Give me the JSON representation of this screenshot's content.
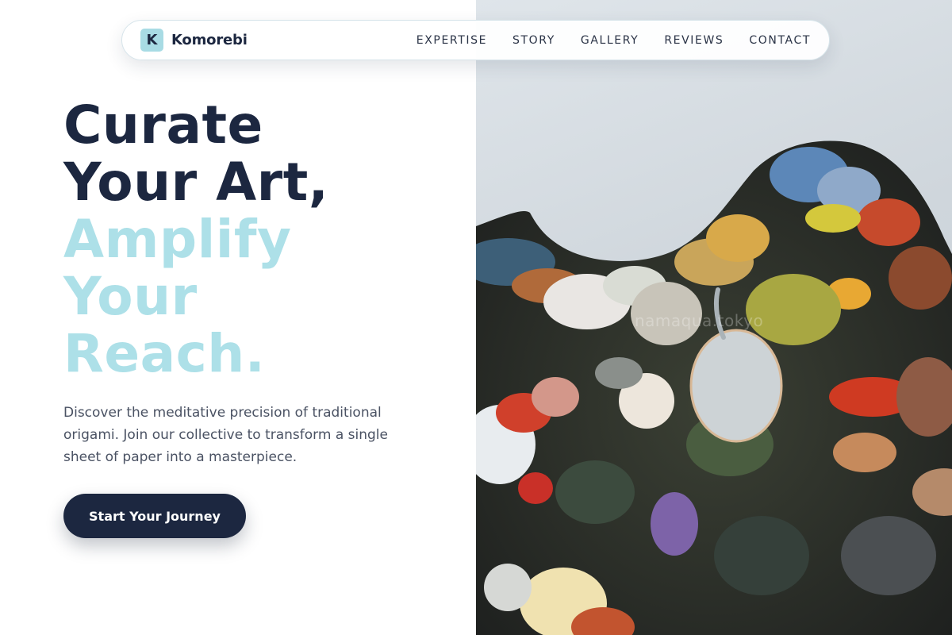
{
  "brand": {
    "mark": "K",
    "name": "Komorebi"
  },
  "nav": {
    "links": [
      "EXPERTISE",
      "STORY",
      "GALLERY",
      "REVIEWS",
      "CONTACT"
    ]
  },
  "hero": {
    "headline_dark": [
      "Curate",
      "Your Art,"
    ],
    "headline_light": [
      "Amplify",
      "Your",
      "Reach."
    ],
    "description": "Discover the meditative precision of traditional origami. Join our collective to transform a single sheet of paper into a masterpiece.",
    "cta_label": "Start Your Journey"
  },
  "image": {
    "subject": "paint-palette-photo",
    "watermark": "namaqua.tokyo"
  },
  "colors": {
    "navy": "#1c2740",
    "accent_light": "#ade0e8",
    "brand_mark": "#a8dbe4",
    "text_muted": "#4a5263"
  }
}
